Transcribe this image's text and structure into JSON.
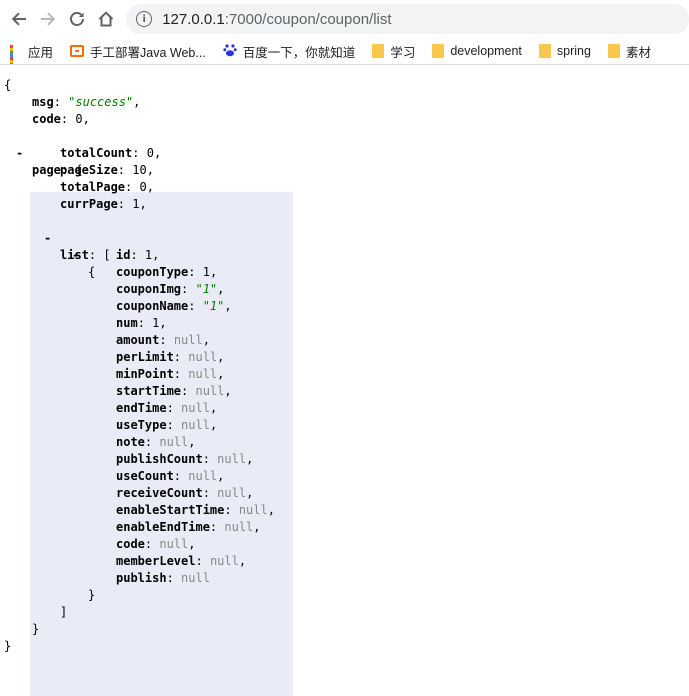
{
  "browser": {
    "url_host": "127.0.0.1",
    "url_path": ":7000/coupon/coupon/list",
    "bookmarks": [
      {
        "label": "应用",
        "icon": "apps-icon"
      },
      {
        "label": "手工部署Java Web...",
        "icon": "aliyun-icon"
      },
      {
        "label": "百度一下，你就知道",
        "icon": "baidu-icon"
      },
      {
        "label": "学习",
        "icon": "folder-icon"
      },
      {
        "label": "development",
        "icon": "folder-icon"
      },
      {
        "label": "spring",
        "icon": "folder-icon"
      },
      {
        "label": "素材",
        "icon": "folder-icon"
      }
    ]
  },
  "json": {
    "open_brace": "{",
    "close_brace": "}",
    "collapse_symbol": "-",
    "msg": {
      "key": "msg",
      "value": "\"success\""
    },
    "code": {
      "key": "code",
      "value": "0"
    },
    "page": {
      "key": "page",
      "totalCount": {
        "key": "totalCount",
        "value": "0"
      },
      "pageSize": {
        "key": "pageSize",
        "value": "10"
      },
      "totalPage": {
        "key": "totalPage",
        "value": "0"
      },
      "currPage": {
        "key": "currPage",
        "value": "1"
      },
      "list_key": "list",
      "item": [
        {
          "key": "id",
          "value": "1",
          "type": "num"
        },
        {
          "key": "couponType",
          "value": "1",
          "type": "num"
        },
        {
          "key": "couponImg",
          "value": "\"1\"",
          "type": "str"
        },
        {
          "key": "couponName",
          "value": "\"1\"",
          "type": "str"
        },
        {
          "key": "num",
          "value": "1",
          "type": "num"
        },
        {
          "key": "amount",
          "value": "null",
          "type": "null"
        },
        {
          "key": "perLimit",
          "value": "null",
          "type": "null"
        },
        {
          "key": "minPoint",
          "value": "null",
          "type": "null"
        },
        {
          "key": "startTime",
          "value": "null",
          "type": "null"
        },
        {
          "key": "endTime",
          "value": "null",
          "type": "null"
        },
        {
          "key": "useType",
          "value": "null",
          "type": "null"
        },
        {
          "key": "note",
          "value": "null",
          "type": "null"
        },
        {
          "key": "publishCount",
          "value": "null",
          "type": "null"
        },
        {
          "key": "useCount",
          "value": "null",
          "type": "null"
        },
        {
          "key": "receiveCount",
          "value": "null",
          "type": "null"
        },
        {
          "key": "enableStartTime",
          "value": "null",
          "type": "null"
        },
        {
          "key": "enableEndTime",
          "value": "null",
          "type": "null"
        },
        {
          "key": "code",
          "value": "null",
          "type": "null"
        },
        {
          "key": "memberLevel",
          "value": "null",
          "type": "null"
        },
        {
          "key": "publish",
          "value": "null",
          "type": "null"
        }
      ]
    }
  },
  "colors": {
    "string": "#008000",
    "null": "#888888",
    "highlight": "#e9ecf7",
    "folder": "#f8c74c"
  }
}
